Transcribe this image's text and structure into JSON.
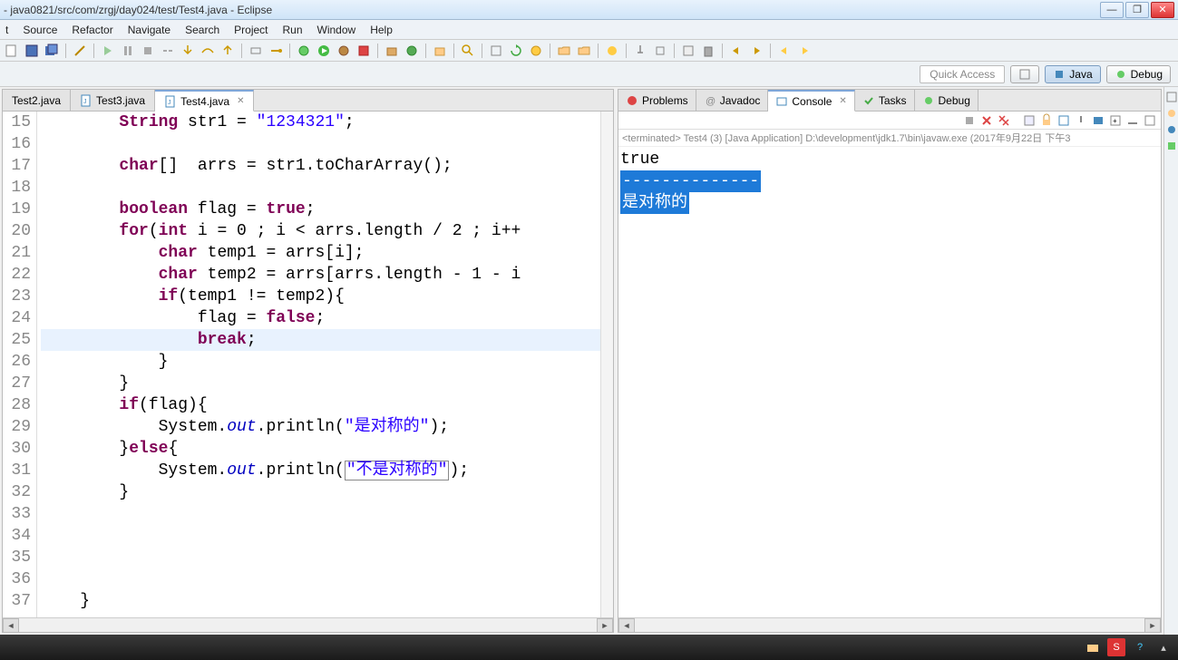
{
  "title": "- java0821/src/com/zrgj/day024/test/Test4.java - Eclipse",
  "menu": [
    "t",
    "Source",
    "Refactor",
    "Navigate",
    "Search",
    "Project",
    "Run",
    "Window",
    "Help"
  ],
  "quick_access": "Quick Access",
  "perspectives": [
    {
      "label": "Java"
    },
    {
      "label": "Debug"
    }
  ],
  "editor_tabs": [
    {
      "label": "Test2.java",
      "active": false
    },
    {
      "label": "Test3.java",
      "active": false
    },
    {
      "label": "Test4.java",
      "active": true
    }
  ],
  "code_lines": [
    {
      "n": 15,
      "raw": "        String str1 = \"1234321\";"
    },
    {
      "n": 16,
      "raw": ""
    },
    {
      "n": 17,
      "raw": "        char[]  arrs = str1.toCharArray();"
    },
    {
      "n": 18,
      "raw": ""
    },
    {
      "n": 19,
      "raw": "        boolean flag = true;"
    },
    {
      "n": 20,
      "raw": "        for(int i = 0 ; i < arrs.length / 2 ; i++"
    },
    {
      "n": 21,
      "raw": "            char temp1 = arrs[i];"
    },
    {
      "n": 22,
      "raw": "            char temp2 = arrs[arrs.length - 1 - i"
    },
    {
      "n": 23,
      "raw": "            if(temp1 != temp2){"
    },
    {
      "n": 24,
      "raw": "                flag = false;"
    },
    {
      "n": 25,
      "raw": "                break;",
      "hl": true
    },
    {
      "n": 26,
      "raw": "            }"
    },
    {
      "n": 27,
      "raw": "        }"
    },
    {
      "n": 28,
      "raw": "        if(flag){"
    },
    {
      "n": 29,
      "raw": "            System.out.println(\"是对称的\");"
    },
    {
      "n": 30,
      "raw": "        }else{"
    },
    {
      "n": 31,
      "raw": "            System.out.println(\"不是对称的\");"
    },
    {
      "n": 32,
      "raw": "        }"
    },
    {
      "n": 33,
      "raw": ""
    },
    {
      "n": 34,
      "raw": ""
    },
    {
      "n": 35,
      "raw": ""
    },
    {
      "n": 36,
      "raw": ""
    },
    {
      "n": 37,
      "raw": "    }"
    }
  ],
  "views": [
    {
      "label": "Problems",
      "icon": "problems-icon"
    },
    {
      "label": "Javadoc",
      "icon": "javadoc-icon"
    },
    {
      "label": "Console",
      "icon": "console-icon",
      "active": true
    },
    {
      "label": "Tasks",
      "icon": "tasks-icon"
    },
    {
      "label": "Debug",
      "icon": "debug-icon"
    }
  ],
  "console_header": "<terminated> Test4 (3) [Java Application] D:\\development\\jdk1.7\\bin\\javaw.exe (2017年9月22日 下午3",
  "console_output": [
    {
      "text": "true",
      "selected": false
    },
    {
      "text": "--------------",
      "selected": true
    },
    {
      "text": "是对称的",
      "selected": true
    }
  ]
}
